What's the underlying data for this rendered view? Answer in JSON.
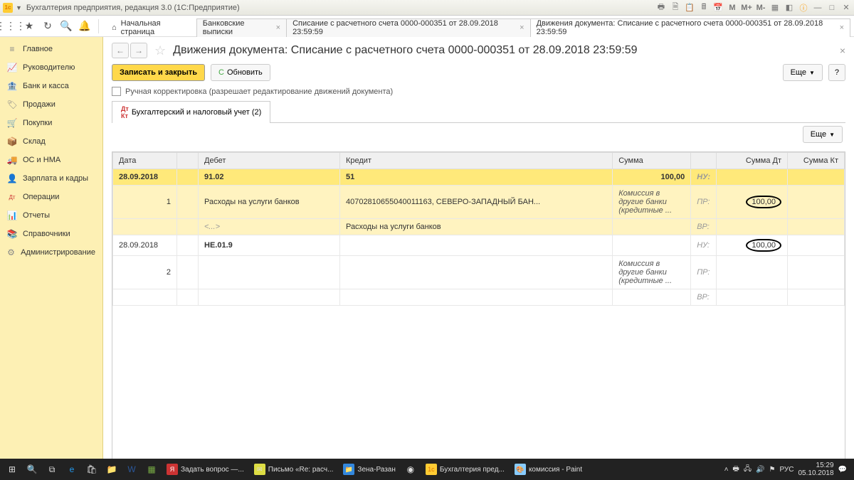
{
  "window": {
    "title": "Бухгалтерия предприятия, редакция 3.0  (1С:Предприятие)"
  },
  "navTabs": {
    "home": "Начальная страница",
    "t1": "Банковские выписки",
    "t2": "Списание с расчетного счета 0000-000351 от 28.09.2018 23:59:59",
    "t3": "Движения документа: Списание с расчетного счета 0000-000351 от 28.09.2018 23:59:59"
  },
  "sidebar": [
    {
      "icon": "≡",
      "label": "Главное"
    },
    {
      "icon": "📈",
      "label": "Руководителю"
    },
    {
      "icon": "🏦",
      "label": "Банк и касса"
    },
    {
      "icon": "🏷",
      "label": "Продажи"
    },
    {
      "icon": "🛒",
      "label": "Покупки"
    },
    {
      "icon": "📦",
      "label": "Склад"
    },
    {
      "icon": "🚚",
      "label": "ОС и НМА"
    },
    {
      "icon": "👤",
      "label": "Зарплата и кадры"
    },
    {
      "icon": "Дт",
      "label": "Операции"
    },
    {
      "icon": "📊",
      "label": "Отчеты"
    },
    {
      "icon": "📚",
      "label": "Справочники"
    },
    {
      "icon": "⚙",
      "label": "Администрирование"
    }
  ],
  "doc": {
    "title": "Движения документа: Списание с расчетного счета 0000-000351 от 28.09.2018 23:59:59",
    "saveClose": "Записать и закрыть",
    "refresh": "Обновить",
    "more": "Еще",
    "manualEdit": "Ручная корректировка (разрешает редактирование движений документа)",
    "subtab": "Бухгалтерский и налоговый учет (2)"
  },
  "table": {
    "headers": {
      "date": "Дата",
      "debit": "Дебет",
      "credit": "Кредит",
      "sum": "Сумма",
      "sumDt": "Сумма Дт",
      "sumKt": "Сумма Кт"
    },
    "r1": {
      "date": "28.09.2018",
      "debit": "91.02",
      "credit": "51",
      "sum": "100,00",
      "nu": "НУ:"
    },
    "r1a": {
      "n": "1",
      "debit": "Расходы на услуги банков",
      "credit": "40702810655040011163, СЕВЕРО-ЗАПАДНЫЙ БАН...",
      "desc": "Комиссия в другие банки (кредитные ...",
      "pr": "ПР:",
      "val": "100,00"
    },
    "r1b": {
      "debit": "<...>",
      "credit": "Расходы на услуги банков",
      "vr": "ВР:"
    },
    "r2": {
      "date": "28.09.2018",
      "debit": "НЕ.01.9",
      "nu": "НУ:",
      "val": "100,00"
    },
    "r2a": {
      "n": "2",
      "desc": "Комиссия в другие банки (кредитные ...",
      "pr": "ПР:"
    },
    "r2b": {
      "vr": "ВР:"
    }
  },
  "taskbar": {
    "apps": [
      {
        "color": "#c33",
        "label": "Задать вопрос —..."
      },
      {
        "color": "#dd4",
        "label": "Письмо «Re: расч..."
      },
      {
        "color": "#38d",
        "label": "Зена-Разан"
      },
      {
        "color": "#fc3",
        "label": "Бухгалтерия пред..."
      },
      {
        "color": "#8cf",
        "label": "комиссия - Paint"
      }
    ],
    "lang": "РУС",
    "time": "15:29",
    "date": "05.10.2018"
  }
}
